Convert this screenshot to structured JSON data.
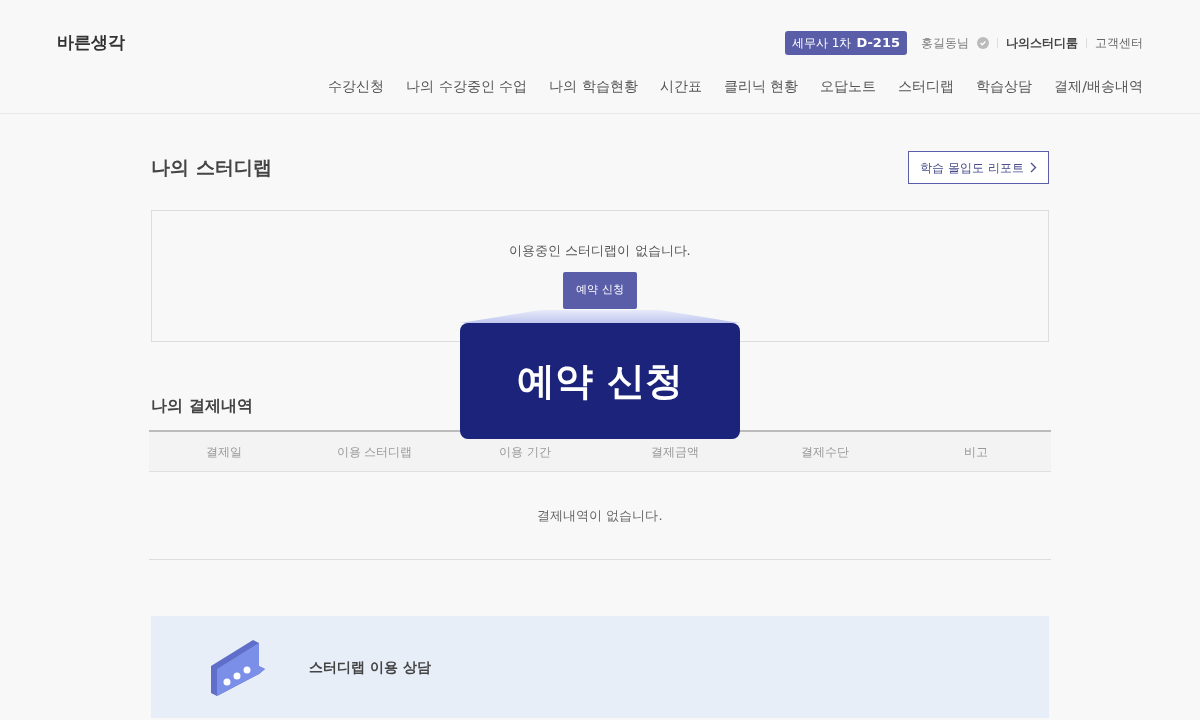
{
  "header": {
    "logo": "바른생각",
    "badge": {
      "label": "세무사 1차",
      "dday": "D-215"
    },
    "user": {
      "name": "홍길동님"
    },
    "links": [
      "나의스터디룸",
      "고객센터"
    ]
  },
  "nav": [
    "수강신청",
    "나의 수강중인 수업",
    "나의 학습현황",
    "시간표",
    "클리닉 현황",
    "오답노트",
    "스터디랩",
    "학습상담",
    "결제/배송내역"
  ],
  "study": {
    "title": "나의 스터디랩",
    "report_button": "학습 몰입도 리포트",
    "empty_text": "이용중인 스터디랩이 없습니다.",
    "reserve_button": "예약 신청"
  },
  "callout": {
    "label": "예약 신청"
  },
  "payments": {
    "title": "나의 결제내역",
    "columns": [
      "결제일",
      "이용 스터디랩",
      "이용 기간",
      "결제금액",
      "결제수단",
      "비고"
    ],
    "empty_text": "결제내역이 없습니다."
  },
  "consult": {
    "label": "스터디랩 이용 상담"
  }
}
